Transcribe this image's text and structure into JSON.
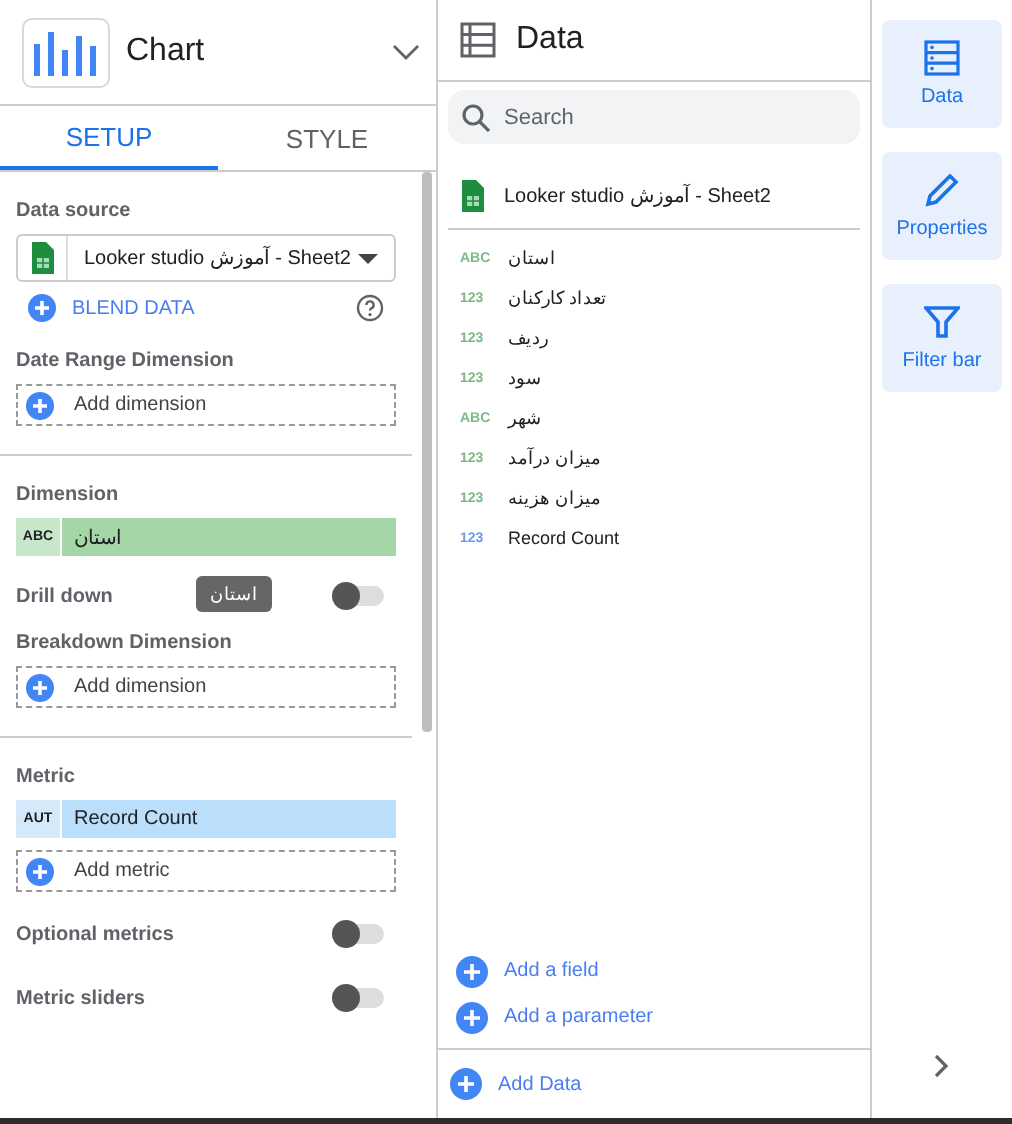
{
  "chart_header": {
    "title": "Chart"
  },
  "tabs": [
    {
      "label": "SETUP",
      "selected": true
    },
    {
      "label": "STYLE",
      "selected": false
    }
  ],
  "data_source": {
    "label": "Data source",
    "value": "Looker studio آموزش - Sheet2",
    "blend": "BLEND DATA"
  },
  "date_range": {
    "label": "Date Range Dimension",
    "add": "Add dimension"
  },
  "dimension": {
    "label": "Dimension",
    "chip": {
      "kind": "dimension",
      "type": "ABC",
      "name": "استان"
    },
    "drill_down": {
      "label": "Drill down",
      "on": false
    },
    "tooltip": "استان",
    "breakdown_label": "Breakdown Dimension",
    "add": "Add dimension"
  },
  "metric": {
    "label": "Metric",
    "chip": {
      "kind": "metric",
      "type": "AUT",
      "name": "Record Count"
    },
    "add": "Add metric"
  },
  "toggles": [
    {
      "label": "Optional metrics",
      "on": false
    },
    {
      "label": "Metric sliders",
      "on": false
    }
  ],
  "data_panel": {
    "title": "Data",
    "search": {
      "placeholder": "Search"
    },
    "source": "Looker studio آموزش - Sheet2",
    "fields": [
      {
        "kind": "dimension",
        "type": "ABC",
        "name": "استان"
      },
      {
        "kind": "dimension",
        "type": "123",
        "name": "تعداد کارکنان"
      },
      {
        "kind": "dimension",
        "type": "123",
        "name": "ردیف"
      },
      {
        "kind": "dimension",
        "type": "123",
        "name": "سود"
      },
      {
        "kind": "dimension",
        "type": "ABC",
        "name": "شهر"
      },
      {
        "kind": "dimension",
        "type": "123",
        "name": "میزان درآمد"
      },
      {
        "kind": "dimension",
        "type": "123",
        "name": "میزان هزینه"
      },
      {
        "kind": "metric",
        "type": "123",
        "name": "Record Count"
      }
    ],
    "actions": [
      "Add a field",
      "Add a parameter"
    ],
    "add_data": "Add Data"
  },
  "side_buttons": [
    {
      "kind": "data",
      "label": "Data"
    },
    {
      "kind": "properties",
      "label": "Properties"
    },
    {
      "kind": "filter",
      "label": "Filter bar"
    }
  ]
}
